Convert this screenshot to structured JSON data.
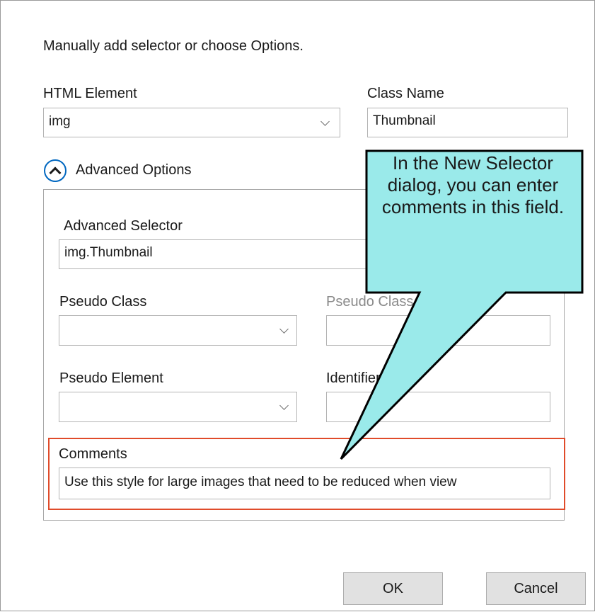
{
  "dialog": {
    "instruction": "Manually add selector or choose Options."
  },
  "html_element": {
    "label": "HTML Element",
    "value": "img"
  },
  "class_name": {
    "label": "Class Name",
    "value": "Thumbnail"
  },
  "advanced_options": {
    "label": "Advanced Options",
    "expanded": true
  },
  "advanced_selector": {
    "label": "Advanced Selector",
    "value": "img.Thumbnail"
  },
  "pseudo_class": {
    "label": "Pseudo Class",
    "value": ""
  },
  "pseudo_class_parameter": {
    "label": "Pseudo Class Parameter",
    "value": ""
  },
  "pseudo_element": {
    "label": "Pseudo Element",
    "value": ""
  },
  "identifier": {
    "label": "Identifier (ID)",
    "value": ""
  },
  "comments": {
    "label": "Comments",
    "value": "Use this style for large images that need to be reduced when view"
  },
  "buttons": {
    "ok": "OK",
    "cancel": "Cancel"
  },
  "callout": {
    "text": "In the New Selector dialog, you can enter comments in this field."
  },
  "colors": {
    "callout_fill": "#9aeaea",
    "highlight_border": "#e04b2a",
    "toggle_accent": "#0067c0"
  }
}
